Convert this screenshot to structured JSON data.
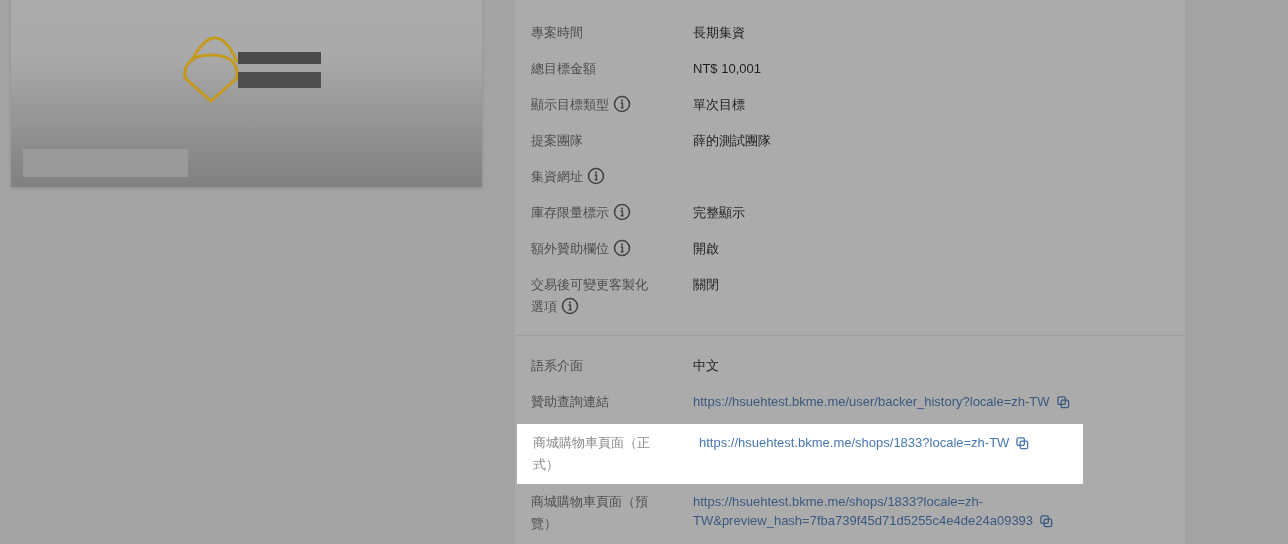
{
  "sections": [
    {
      "rows": [
        {
          "label": "專案時間",
          "info": false,
          "value": "長期集資",
          "link": false,
          "highlighted": false
        },
        {
          "label": "總目標金額",
          "info": false,
          "value": "NT$ 10,001",
          "link": false,
          "highlighted": false
        },
        {
          "label": "顯示目標類型",
          "info": true,
          "value": "單次目標",
          "link": false,
          "highlighted": false
        },
        {
          "label": "提案團隊",
          "info": false,
          "value": "薛的測試團隊",
          "link": false,
          "highlighted": false
        },
        {
          "label": "集資網址",
          "info": true,
          "highlighted": false
        },
        {
          "label": "庫存限量標示",
          "info": true,
          "value": "完整顯示",
          "link": false,
          "highlighted": false
        },
        {
          "label": "額外贊助欄位",
          "info": true,
          "value": "開啟",
          "link": false,
          "highlighted": false
        },
        {
          "label": "交易後可變更客製化選項",
          "info": true,
          "value": "關閉",
          "link": false,
          "highlighted": false
        }
      ]
    },
    {
      "rows": [
        {
          "label": "語系介面",
          "info": false,
          "value": "中文",
          "link": false,
          "highlighted": false
        },
        {
          "label": "贊助查詢連結",
          "info": false,
          "value": "https://hsuehtest.bkme.me/user/backer_history?locale=zh-TW",
          "link": true,
          "highlighted": false
        },
        {
          "label": "商城購物車頁面（正式）",
          "info": false,
          "value": "https://hsuehtest.bkme.me/shops/1833?locale=zh-TW",
          "link": true,
          "highlighted": true
        },
        {
          "label": "商城購物車頁面（預覽）",
          "info": false,
          "value": "https://hsuehtest.bkme.me/shops/1833?locale=zh-TW&preview_hash=7fba739f45d71d5255c4e4de24a09393",
          "link": true,
          "highlighted": false
        }
      ]
    }
  ]
}
